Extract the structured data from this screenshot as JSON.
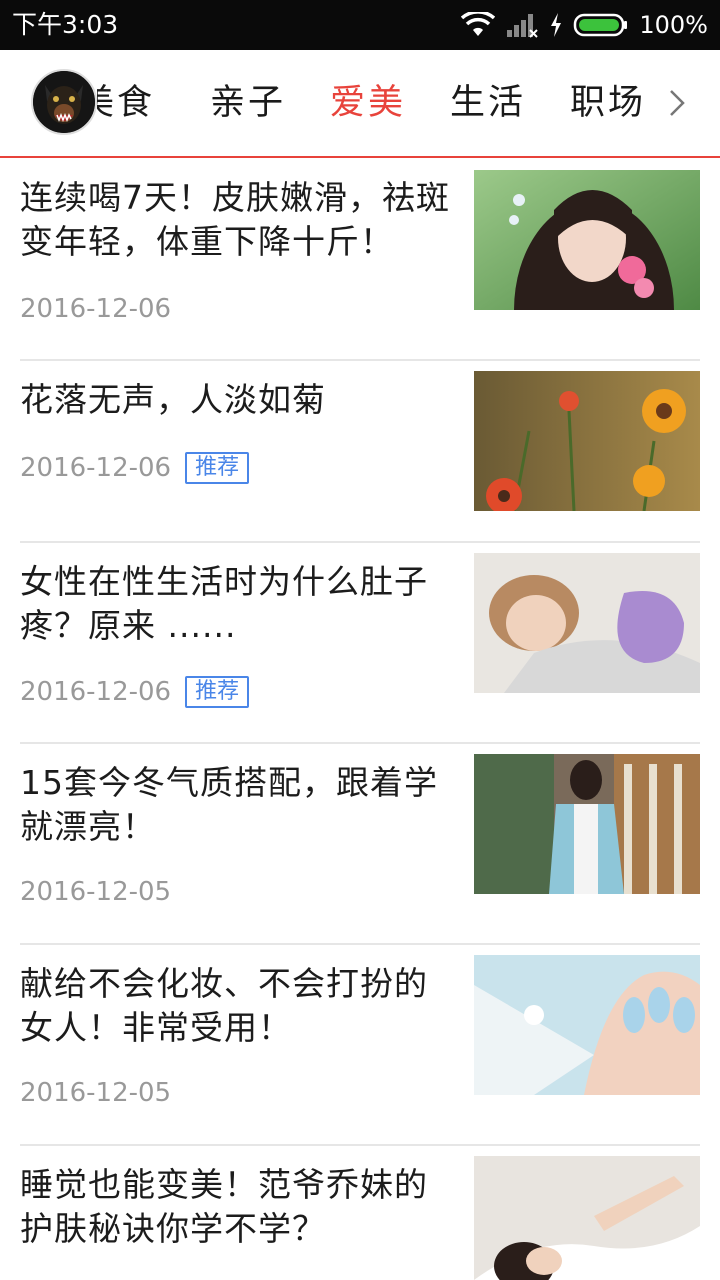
{
  "status": {
    "time": "下午3:03",
    "battery": "100%"
  },
  "tabs": {
    "items": [
      "美食",
      "亲子",
      "爱美",
      "生活",
      "职场"
    ],
    "active": "爱美"
  },
  "articles": [
    {
      "title": "连续喝7天！皮肤嫩滑，祛斑变年轻，体重下降十斤！",
      "date": "2016-12-06",
      "tag": ""
    },
    {
      "title": "花落无声，人淡如菊",
      "date": "2016-12-06",
      "tag": "推荐"
    },
    {
      "title": "女性在性生活时为什么肚子疼？原来 ......",
      "date": "2016-12-06",
      "tag": "推荐"
    },
    {
      "title": "15套今冬气质搭配，跟着学就漂亮！",
      "date": "2016-12-05",
      "tag": ""
    },
    {
      "title": "献给不会化妆、不会打扮的女人！非常受用！",
      "date": "2016-12-05",
      "tag": ""
    },
    {
      "title": "睡觉也能变美！范爷乔妹的护肤秘诀你学不学？",
      "date": "",
      "tag": ""
    }
  ],
  "colors": {
    "accent": "#e8433b",
    "tag": "#4a86e8",
    "date": "#999999"
  },
  "icons": {
    "wifi": "wifi-icon",
    "signal": "signal-icon",
    "charging": "charging-icon",
    "battery": "battery-icon",
    "more": "chevron-right-icon"
  }
}
